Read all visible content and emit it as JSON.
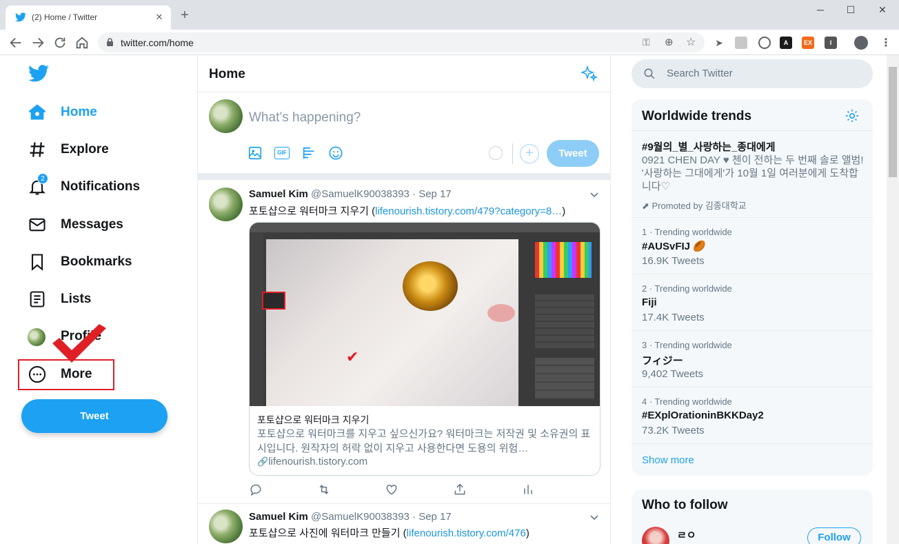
{
  "browser": {
    "tab_title": "(2) Home / Twitter",
    "url": "twitter.com/home",
    "ext_on": "on",
    "ext_a": "A",
    "ext_ex": "EX",
    "ext_i": "I"
  },
  "nav": {
    "home": "Home",
    "explore": "Explore",
    "notifications": "Notifications",
    "notifications_badge": "2",
    "messages": "Messages",
    "bookmarks": "Bookmarks",
    "lists": "Lists",
    "profile": "Profile",
    "more": "More",
    "tweet": "Tweet"
  },
  "feed": {
    "title": "Home",
    "compose_placeholder": "What’s happening?",
    "tweet_button": "Tweet",
    "gif": "GIF",
    "posts": [
      {
        "name": "Samuel Kim",
        "handle": "@SamuelK90038393 · Sep 17",
        "text": "포토샵으로 워터마크 지우기 (",
        "link": "lifenourish.tistory.com/479?category=8…",
        "text_end": ")",
        "card_title": "포토샵으로 워터마크 지우기",
        "card_desc": "포토샵으로 워터마크를 지우고 싶으신가요? 워터마크는 저작권 및 소유권의 표시입니다. 원작자의 허락 없이 지우고 사용한다면 도용의 위험…",
        "card_link": "lifenourish.tistory.com"
      },
      {
        "name": "Samuel Kim",
        "handle": "@SamuelK90038393 · Sep 17",
        "text": "포토샵으로 사진에 워터마크 만들기 (",
        "link": "lifenourish.tistory.com/476",
        "text_end": ")"
      }
    ]
  },
  "sidebar": {
    "search_placeholder": "Search Twitter",
    "trends_title": "Worldwide trends",
    "trends": [
      {
        "name": "#9월의_별_사랑하는_종대에게",
        "desc": "0921 CHEN DAY ♥ 첸이 전하는 두 번째 솔로 앨범! '사랑하는 그대에게'가 10월 1일 여러분에게 도착합니다♡",
        "promoted": "Promoted by 김종대학교"
      },
      {
        "sub": "1 · Trending worldwide",
        "name": "#AUSvFIJ 🏉",
        "count": "16.9K Tweets"
      },
      {
        "sub": "2 · Trending worldwide",
        "name": "Fiji",
        "count": "17.4K Tweets"
      },
      {
        "sub": "3 · Trending worldwide",
        "name": "フィジー",
        "count": "9,402 Tweets"
      },
      {
        "sub": "4 · Trending worldwide",
        "name": "#EXplOrationinBKKDay2",
        "count": "73.2K Tweets"
      }
    ],
    "show_more": "Show more",
    "who_title": "Who to follow",
    "who_name": "ㄹㅇ",
    "follow": "Follow"
  },
  "colors": {
    "accent": "#1da1f2",
    "annotation": "#e01e25"
  }
}
